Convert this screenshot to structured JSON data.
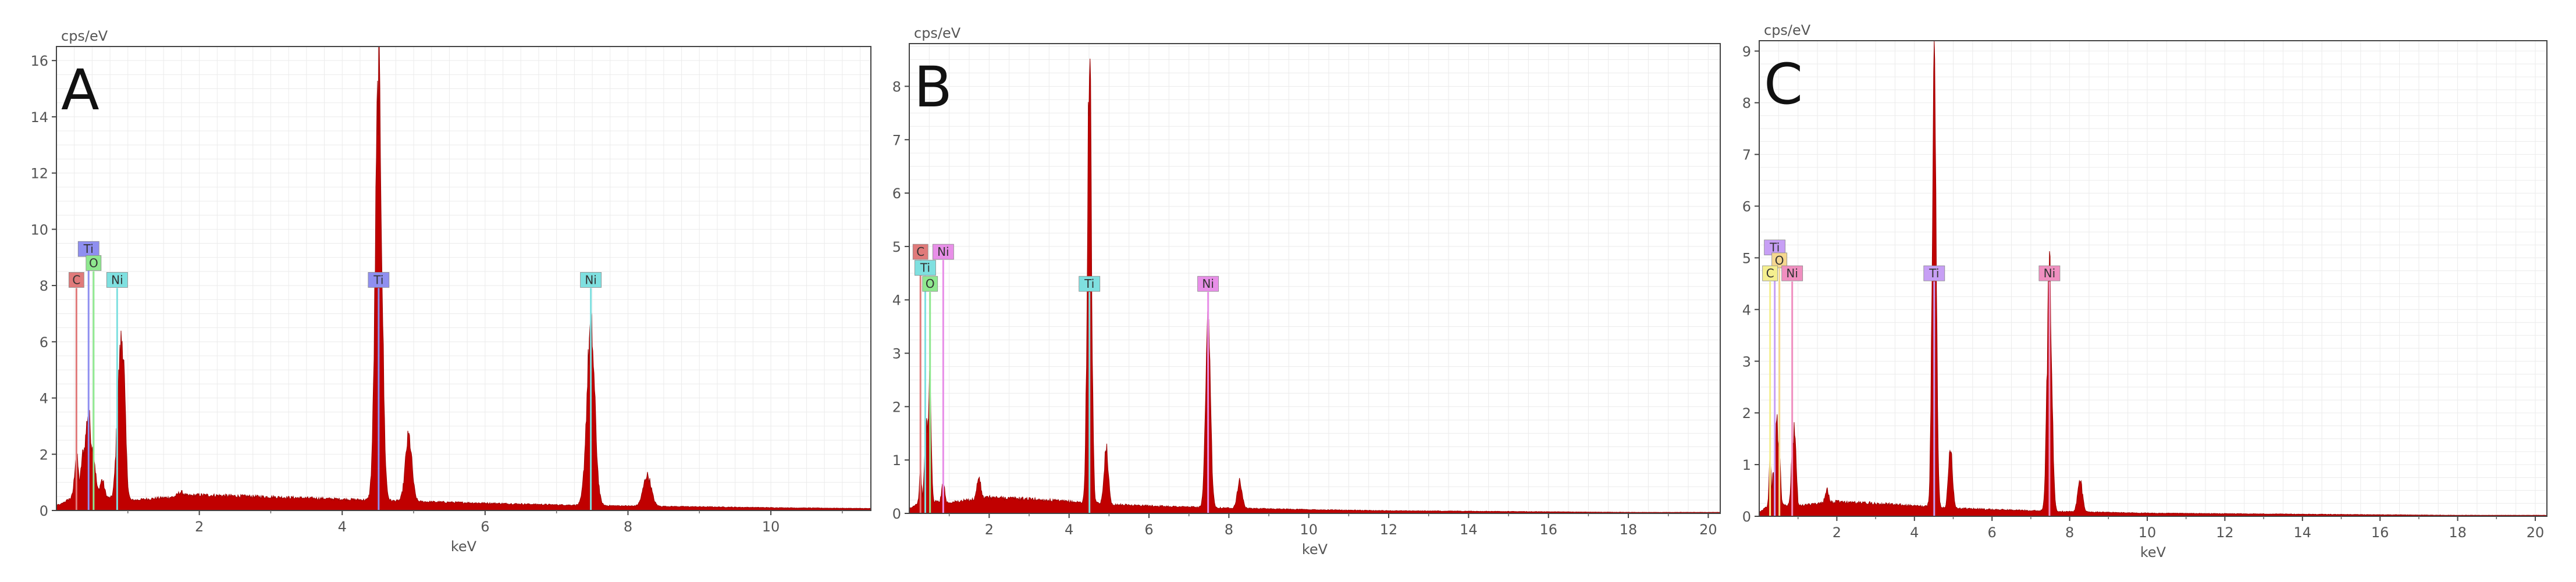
{
  "chart_data": [
    {
      "type": "area",
      "panel_label": "A",
      "ylabel": "cps/eV",
      "xlabel": "keV",
      "xlim": [
        0,
        11.4
      ],
      "ylim": [
        0,
        16.5
      ],
      "x_ticks": [
        2,
        4,
        6,
        8,
        10
      ],
      "y_ticks": [
        0,
        2,
        4,
        6,
        8,
        10,
        12,
        14,
        16
      ],
      "grid": true,
      "spectrum_color": "#c00000",
      "background": [
        [
          0.05,
          0.2
        ],
        [
          0.3,
          0.6
        ],
        [
          1.0,
          0.35
        ],
        [
          1.5,
          0.45
        ],
        [
          2.0,
          0.55
        ],
        [
          3.0,
          0.48
        ],
        [
          4.0,
          0.4
        ],
        [
          5.0,
          0.32
        ],
        [
          6.0,
          0.26
        ],
        [
          7.0,
          0.2
        ],
        [
          8.0,
          0.16
        ],
        [
          9.0,
          0.13
        ],
        [
          10.0,
          0.1
        ],
        [
          11.4,
          0.07
        ]
      ],
      "peaks": [
        [
          0.28,
          1.4,
          0.025
        ],
        [
          0.36,
          1.0,
          0.02
        ],
        [
          0.4,
          1.0,
          0.025
        ],
        [
          0.45,
          2.7,
          0.03
        ],
        [
          0.52,
          1.3,
          0.03
        ],
        [
          0.64,
          0.6,
          0.03
        ],
        [
          0.87,
          3.1,
          0.035
        ],
        [
          0.93,
          4.8,
          0.035
        ],
        [
          1.74,
          0.15,
          0.04
        ],
        [
          4.51,
          14.9,
          0.045
        ],
        [
          4.93,
          2.3,
          0.045
        ],
        [
          7.48,
          6.3,
          0.055
        ],
        [
          8.27,
          1.1,
          0.055
        ]
      ],
      "markers": [
        {
          "label": "C",
          "x": 0.28,
          "y": 8.2,
          "color": "#e07a7a"
        },
        {
          "label": "Ti",
          "x": 0.45,
          "y": 9.3,
          "color": "#8f8ff0"
        },
        {
          "label": "O",
          "x": 0.52,
          "y": 8.8,
          "color": "#8fe88f"
        },
        {
          "label": "Ni",
          "x": 0.85,
          "y": 8.2,
          "color": "#7fe0e0"
        },
        {
          "label": "Ti",
          "x": 4.51,
          "y": 8.2,
          "color": "#8f8ff0"
        },
        {
          "label": "Ni",
          "x": 7.48,
          "y": 8.2,
          "color": "#7fe0e0"
        }
      ]
    },
    {
      "type": "area",
      "panel_label": "B",
      "ylabel": "cps/eV",
      "xlabel": "keV",
      "xlim": [
        0,
        20.3
      ],
      "ylim": [
        0,
        8.8
      ],
      "x_ticks": [
        2,
        4,
        6,
        8,
        10,
        12,
        14,
        16,
        18,
        20
      ],
      "y_ticks": [
        0,
        1,
        2,
        3,
        4,
        5,
        6,
        7,
        8
      ],
      "grid": true,
      "spectrum_color": "#c00000",
      "background": [
        [
          0.05,
          0.1
        ],
        [
          0.3,
          0.25
        ],
        [
          1.0,
          0.2
        ],
        [
          2.0,
          0.3
        ],
        [
          3.0,
          0.27
        ],
        [
          4.0,
          0.22
        ],
        [
          5.0,
          0.17
        ],
        [
          6.0,
          0.14
        ],
        [
          7.0,
          0.12
        ],
        [
          8.0,
          0.1
        ],
        [
          10.0,
          0.07
        ],
        [
          12.0,
          0.05
        ],
        [
          14.0,
          0.04
        ],
        [
          16.0,
          0.03
        ],
        [
          18.0,
          0.02
        ],
        [
          20.3,
          0.02
        ]
      ],
      "peaks": [
        [
          0.28,
          0.6,
          0.025
        ],
        [
          0.4,
          1.0,
          0.025
        ],
        [
          0.45,
          1.1,
          0.03
        ],
        [
          0.52,
          2.3,
          0.03
        ],
        [
          0.85,
          0.4,
          0.035
        ],
        [
          1.74,
          0.4,
          0.045
        ],
        [
          4.51,
          8.4,
          0.05
        ],
        [
          4.93,
          1.1,
          0.05
        ],
        [
          7.48,
          3.4,
          0.06
        ],
        [
          8.27,
          0.5,
          0.06
        ]
      ],
      "markers": [
        {
          "label": "C",
          "x": 0.28,
          "y": 4.9,
          "color": "#e07a7a"
        },
        {
          "label": "Ti",
          "x": 0.4,
          "y": 4.6,
          "color": "#7fe0e0"
        },
        {
          "label": "O",
          "x": 0.52,
          "y": 4.3,
          "color": "#8fe88f"
        },
        {
          "label": "Ni",
          "x": 0.85,
          "y": 4.9,
          "color": "#e88fe8"
        },
        {
          "label": "Ti",
          "x": 4.51,
          "y": 4.3,
          "color": "#7fe0e0"
        },
        {
          "label": "Ni",
          "x": 7.48,
          "y": 4.3,
          "color": "#e88fe8"
        }
      ]
    },
    {
      "type": "area",
      "panel_label": "C",
      "ylabel": "cps/eV",
      "xlabel": "keV",
      "xlim": [
        0,
        20.3
      ],
      "ylim": [
        0,
        9.2
      ],
      "x_ticks": [
        2,
        4,
        6,
        8,
        10,
        12,
        14,
        16,
        18,
        20
      ],
      "y_ticks": [
        0,
        1,
        2,
        3,
        4,
        5,
        6,
        7,
        8,
        9
      ],
      "grid": true,
      "spectrum_color": "#c00000",
      "background": [
        [
          0.05,
          0.1
        ],
        [
          0.3,
          0.25
        ],
        [
          1.0,
          0.2
        ],
        [
          2.0,
          0.28
        ],
        [
          3.0,
          0.25
        ],
        [
          4.0,
          0.2
        ],
        [
          5.0,
          0.16
        ],
        [
          6.0,
          0.13
        ],
        [
          7.0,
          0.11
        ],
        [
          8.0,
          0.09
        ],
        [
          10.0,
          0.06
        ],
        [
          12.0,
          0.05
        ],
        [
          14.0,
          0.04
        ],
        [
          16.0,
          0.03
        ],
        [
          18.0,
          0.02
        ],
        [
          20.3,
          0.02
        ]
      ],
      "peaks": [
        [
          0.28,
          0.9,
          0.025
        ],
        [
          0.36,
          0.6,
          0.02
        ],
        [
          0.45,
          1.6,
          0.03
        ],
        [
          0.52,
          1.0,
          0.03
        ],
        [
          0.85,
          0.8,
          0.035
        ],
        [
          0.92,
          1.4,
          0.035
        ],
        [
          1.74,
          0.25,
          0.045
        ],
        [
          4.51,
          8.7,
          0.05
        ],
        [
          4.93,
          1.2,
          0.05
        ],
        [
          7.48,
          4.6,
          0.06
        ],
        [
          8.27,
          0.6,
          0.06
        ]
      ],
      "markers": [
        {
          "label": "Ti",
          "x": 0.4,
          "y": 5.2,
          "color": "#c79ff5"
        },
        {
          "label": "O",
          "x": 0.52,
          "y": 4.95,
          "color": "#f5d78f"
        },
        {
          "label": "C",
          "x": 0.28,
          "y": 4.7,
          "color": "#f5ef8f"
        },
        {
          "label": "Ni",
          "x": 0.85,
          "y": 4.7,
          "color": "#f08fc0"
        },
        {
          "label": "Ti",
          "x": 4.51,
          "y": 4.7,
          "color": "#c79ff5"
        },
        {
          "label": "Ni",
          "x": 7.48,
          "y": 4.7,
          "color": "#f08fc0"
        }
      ]
    }
  ]
}
